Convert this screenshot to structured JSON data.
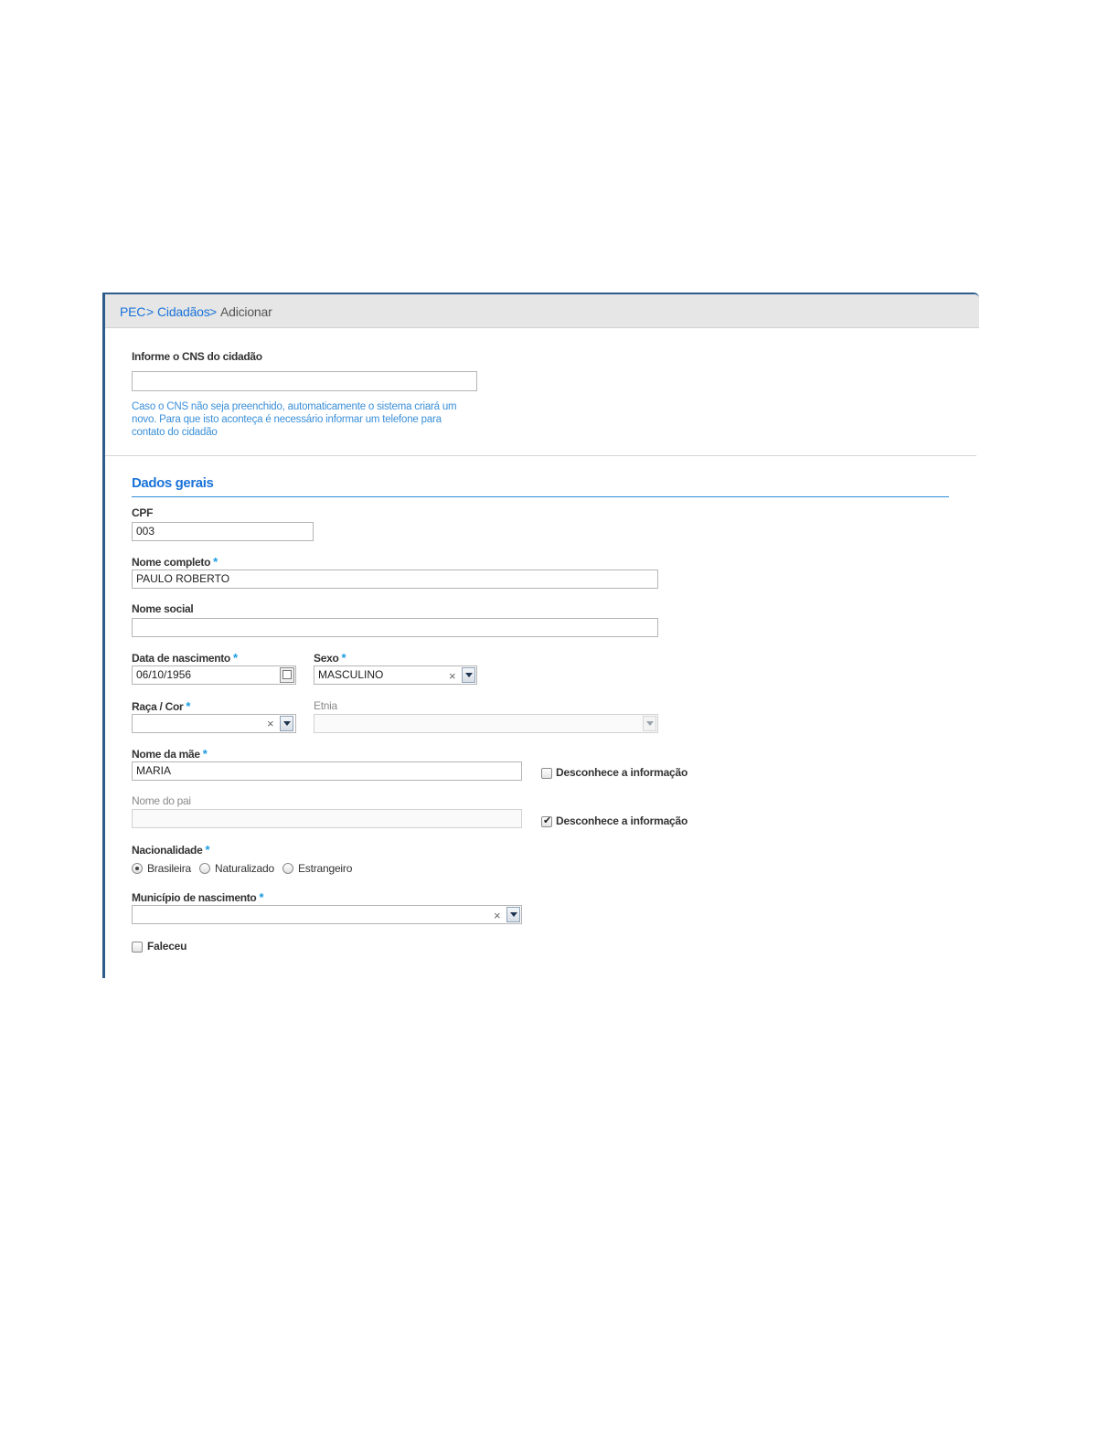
{
  "breadcrumb": {
    "root": "PEC",
    "sep1": ">",
    "section": "Cidadãos",
    "sep2": ">",
    "current": "Adicionar"
  },
  "cns": {
    "label": "Informe o CNS do cidadão",
    "value": "",
    "hint_line1": "Caso o CNS não seja preenchido, automaticamente o sistema criará um",
    "hint_line2": "novo. Para que isto aconteça é necessário informar um telefone para",
    "hint_line3": "contato do cidadão"
  },
  "dados_gerais": {
    "title": "Dados gerais",
    "required_mark": "*",
    "cpf": {
      "label": "CPF",
      "value": "003"
    },
    "nome_completo": {
      "label": "Nome completo",
      "value": "PAULO ROBERTO"
    },
    "nome_social": {
      "label": "Nome social",
      "value": ""
    },
    "data_nascimento": {
      "label": "Data de nascimento",
      "value": "06/10/1956"
    },
    "sexo": {
      "label": "Sexo",
      "value": "MASCULINO"
    },
    "raca_cor": {
      "label": "Raça / Cor",
      "value": ""
    },
    "etnia": {
      "label": "Etnia",
      "value": ""
    },
    "nome_mae": {
      "label": "Nome da mãe",
      "value": "MARIA",
      "unknown_label": "Desconhece a informação",
      "unknown_checked": false
    },
    "nome_pai": {
      "label": "Nome do pai",
      "value": "",
      "unknown_label": "Desconhece a informação",
      "unknown_checked": true
    },
    "nacionalidade": {
      "label": "Nacionalidade",
      "options": [
        "Brasileira",
        "Naturalizado",
        "Estrangeiro"
      ],
      "selected": "Brasileira"
    },
    "municipio": {
      "label": "Município de nascimento",
      "value": ""
    },
    "faleceu": {
      "label": "Faleceu",
      "checked": false
    },
    "clear_glyph": "×",
    "check_glyph": "✔"
  },
  "colors": {
    "accent": "#1a73d9",
    "panel_border": "#2e5c8a",
    "hint": "#3a8fd8",
    "required": "#1a9be0"
  },
  "icons": {
    "calendar": "calendar-icon",
    "dropdown": "chevron-down-icon",
    "clear": "clear-icon"
  }
}
